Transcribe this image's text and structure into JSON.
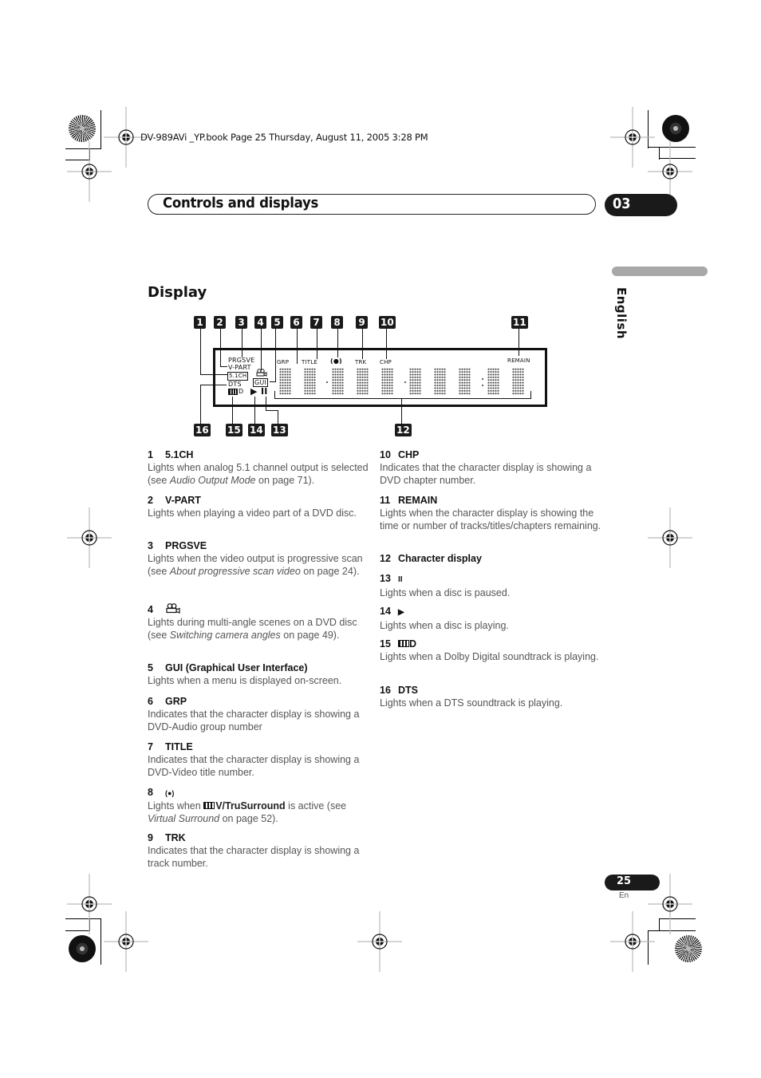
{
  "book_line": "DV-989AVi _YP.book  Page 25  Thursday, August 11, 2005  3:28 PM",
  "header": {
    "title": "Controls and displays",
    "chapter": "03"
  },
  "side_tab": {
    "language": "English"
  },
  "section": {
    "title": "Display"
  },
  "diagram": {
    "callouts": [
      "1",
      "2",
      "3",
      "4",
      "5",
      "6",
      "7",
      "8",
      "9",
      "10",
      "11",
      "12",
      "13",
      "14",
      "15",
      "16"
    ],
    "lcd_labels": {
      "prgsve": "PRGSVE",
      "vpart": "V-PART",
      "ch51": "5.1CH",
      "dts": "DTS",
      "gui": "GUI",
      "dolby_d": "D",
      "grp": "GRP",
      "title": "TITLE",
      "surround": "(●)",
      "trk": "TRK",
      "chp": "CHP",
      "remain": "REMAIN",
      "play": "▶",
      "pause": "II",
      "camera": "camera-icon"
    }
  },
  "items_left": [
    {
      "num": "1",
      "title": "5.1CH",
      "text_a": "Lights when analog 5.1 channel output is selected (see ",
      "italic": "Audio Output Mode",
      "text_b": " on page 71)."
    },
    {
      "num": "2",
      "title": "V-PART",
      "text_a": "Lights when playing a video part of a DVD disc."
    },
    {
      "num": "3",
      "title": "PRGSVE",
      "text_a": "Lights when the video output is progressive scan (see ",
      "italic": "About progressive scan video",
      "text_b": " on page 24)."
    },
    {
      "num": "4",
      "title": "",
      "icon": "camera-icon",
      "text_a": "Lights during multi-angle scenes on a DVD disc (see ",
      "italic": "Switching camera angles",
      "text_b": " on page 49)."
    },
    {
      "num": "5",
      "title": "GUI (Graphical User Interface)",
      "text_a": "Lights when a menu is displayed on-screen."
    },
    {
      "num": "6",
      "title": "GRP",
      "text_a": "Indicates that the character display is showing a DVD-Audio group number"
    },
    {
      "num": "7",
      "title": "TITLE",
      "text_a": "Indicates that the character display is showing a DVD-Video title number."
    },
    {
      "num": "8",
      "title": "(●)",
      "text_a": "Lights when ",
      "bold": "V/TruSurround",
      "text_mid": " is active (see ",
      "italic": "Virtual Surround",
      "text_b": " on page 52)."
    },
    {
      "num": "9",
      "title": "TRK",
      "text_a": "Indicates that the character display is showing a track number."
    }
  ],
  "items_right": [
    {
      "num": "10",
      "title": "CHP",
      "text_a": "Indicates that the character display is showing a DVD chapter number."
    },
    {
      "num": "11",
      "title": "REMAIN",
      "text_a": "Lights when the character display is showing the time or number of tracks/titles/chapters remaining."
    },
    {
      "num": "12",
      "title": "Character display",
      "text_a": ""
    },
    {
      "num": "13",
      "title": "II",
      "text_a": "Lights when a disc is paused."
    },
    {
      "num": "14",
      "title": "▶",
      "text_a": "Lights when a disc is playing."
    },
    {
      "num": "15",
      "title": "D",
      "text_a": "Lights when a Dolby Digital soundtrack is playing."
    },
    {
      "num": "16",
      "title": "DTS",
      "text_a": "Lights when a DTS soundtrack is playing."
    }
  ],
  "footer": {
    "page": "25",
    "lang": "En"
  }
}
